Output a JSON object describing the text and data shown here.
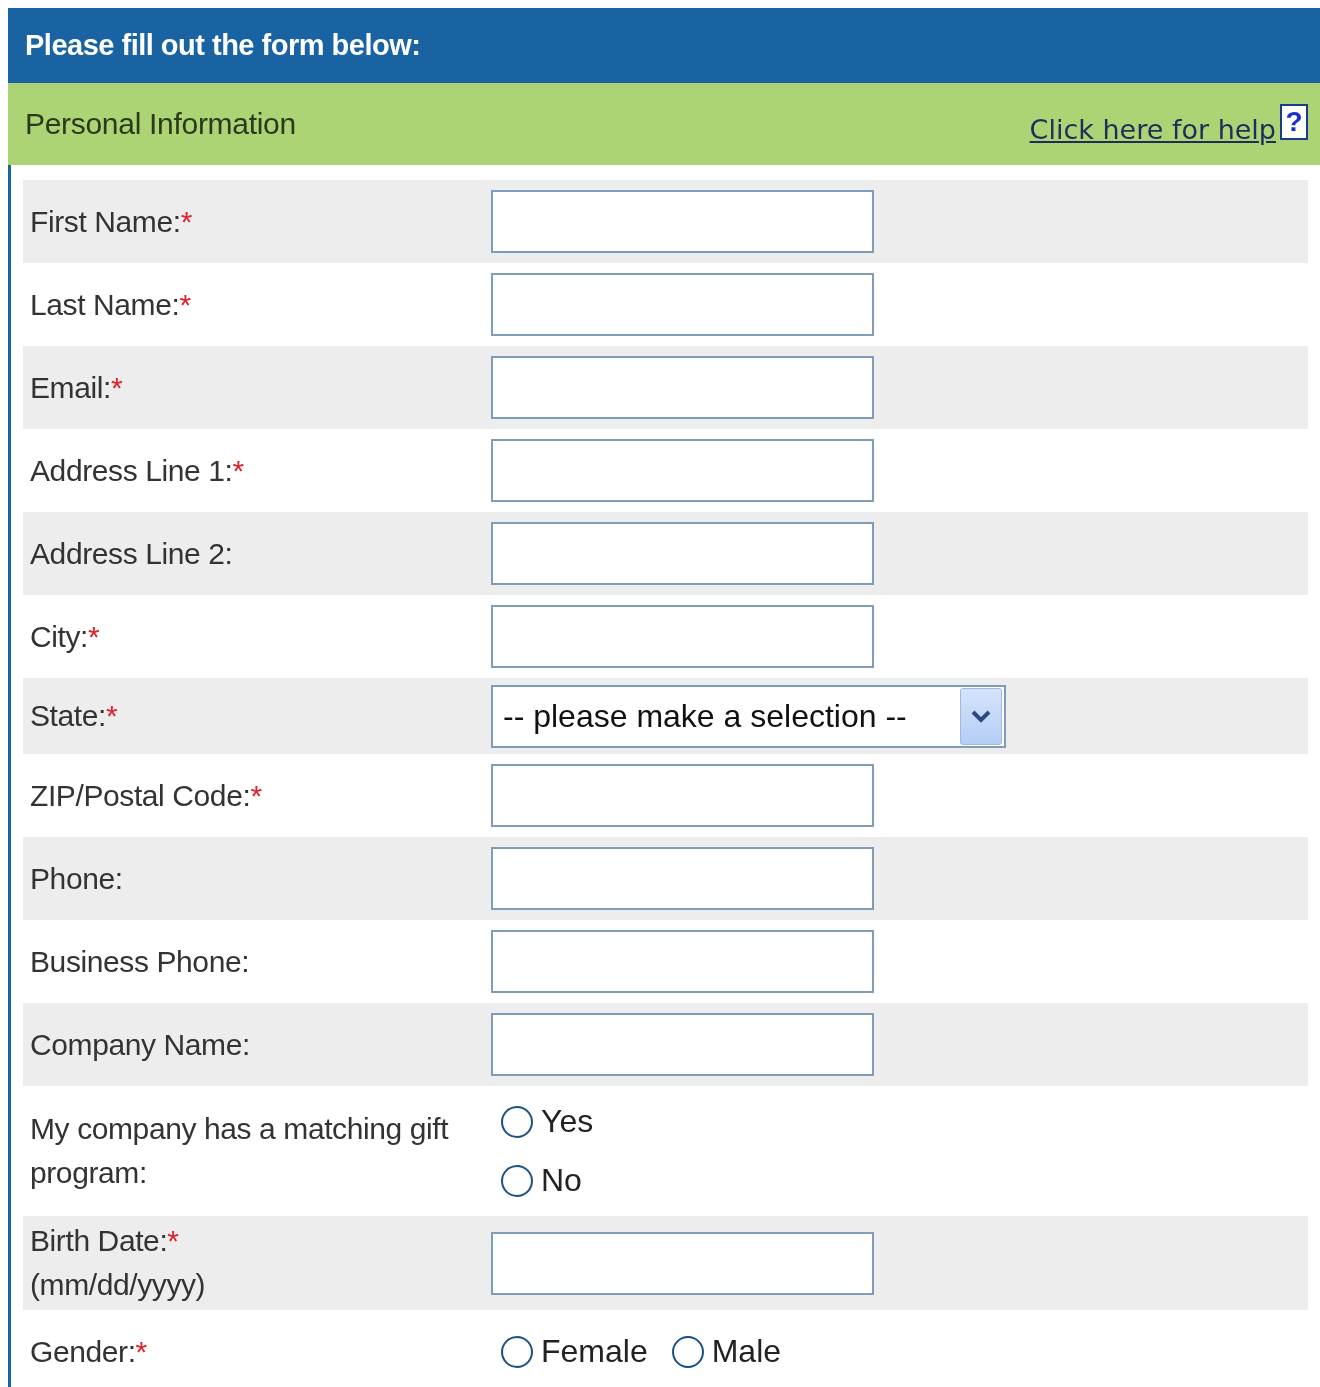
{
  "header": {
    "title": "Please fill out the form below:"
  },
  "required_mark": "*",
  "section": {
    "title": "Personal Information",
    "help_link": "Click here for help",
    "help_icon": "?"
  },
  "fields": [
    {
      "kind": "text",
      "label": "First Name:",
      "required": true
    },
    {
      "kind": "text",
      "label": "Last Name:",
      "required": true
    },
    {
      "kind": "text",
      "label": "Email:",
      "required": true
    },
    {
      "kind": "text",
      "label": "Address Line 1:",
      "required": true
    },
    {
      "kind": "text",
      "label": "Address Line 2:",
      "required": false
    },
    {
      "kind": "text",
      "label": "City:",
      "required": true
    },
    {
      "kind": "select",
      "label": "State:",
      "required": true,
      "value": "-- please make a selection --"
    },
    {
      "kind": "text",
      "label": "ZIP/Postal Code:",
      "required": true
    },
    {
      "kind": "text",
      "label": "Phone:",
      "required": false
    },
    {
      "kind": "text",
      "label": "Business Phone:",
      "required": false
    },
    {
      "kind": "text",
      "label": "Company Name:",
      "required": false
    },
    {
      "kind": "radio-stack",
      "label": "My company has a matching gift program:",
      "required": false,
      "options": [
        {
          "label": "Yes",
          "selected": false
        },
        {
          "label": "No",
          "selected": false
        }
      ]
    },
    {
      "kind": "text",
      "label": "Birth Date:",
      "required": true,
      "hint": "(mm/dd/yyyy)"
    },
    {
      "kind": "radio-row",
      "label": "Gender:",
      "required": true,
      "options": [
        {
          "label": "Female",
          "selected": false
        },
        {
          "label": "Male",
          "selected": false
        }
      ]
    }
  ]
}
